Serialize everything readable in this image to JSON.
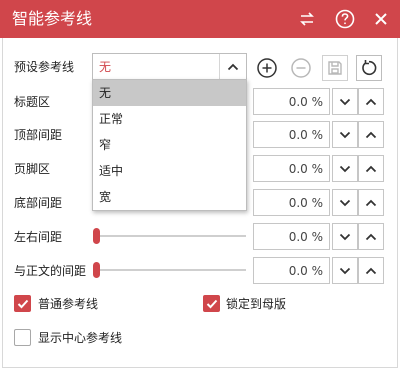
{
  "window": {
    "title": "智能参考线",
    "accent": "#d0464b"
  },
  "titlebar_icons": [
    "swap-icon",
    "help-icon",
    "close-icon"
  ],
  "preset": {
    "label": "预设参考线",
    "value": "无",
    "options": [
      "无",
      "正常",
      "窄",
      "适中",
      "宽"
    ],
    "selected_index": 0
  },
  "toolbar_icons": [
    "add-icon",
    "remove-icon",
    "save-icon",
    "reset-icon"
  ],
  "rows": [
    {
      "label": "标题区",
      "value": "0.0 %"
    },
    {
      "label": "顶部间距",
      "value": "0.0 %"
    },
    {
      "label": "页脚区",
      "value": "0.0 %"
    },
    {
      "label": "底部间距",
      "value": "0.0 %"
    },
    {
      "label": "左右间距",
      "value": "0.0 %",
      "slider": 0
    },
    {
      "label": "与正文的间距",
      "value": "0.0 %",
      "slider": 0
    }
  ],
  "checkboxes": [
    {
      "label": "普通参考线",
      "checked": true
    },
    {
      "label": "锁定到母版",
      "checked": true
    },
    {
      "label": "显示中心参考线",
      "checked": false
    }
  ]
}
